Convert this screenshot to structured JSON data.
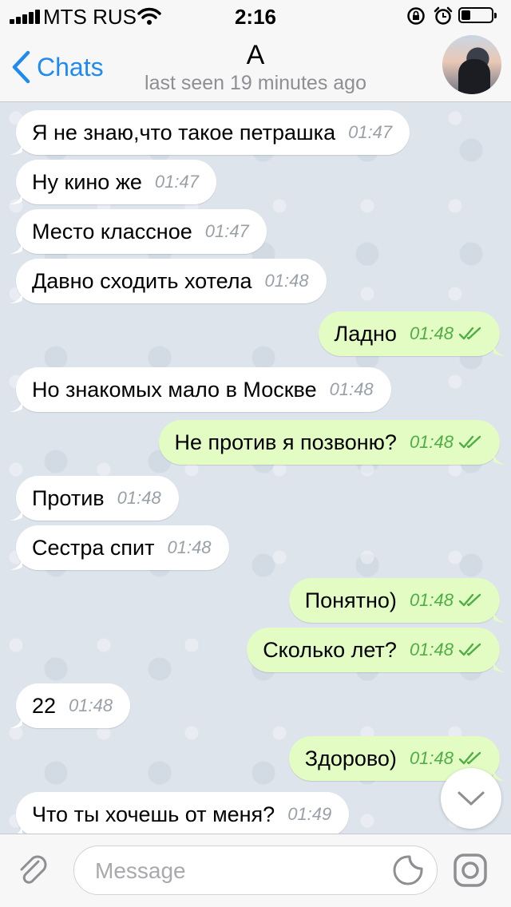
{
  "status_bar": {
    "carrier": "MTS RUS",
    "time": "2:16",
    "battery_level": 0.3
  },
  "header": {
    "back_label": "Chats",
    "title": "A",
    "subtitle": "last seen 19 minutes ago"
  },
  "messages": [
    {
      "dir": "in",
      "text": "Я не знаю,что такое петрашка",
      "time": "01:47"
    },
    {
      "dir": "in",
      "text": "Ну кино же",
      "time": "01:47"
    },
    {
      "dir": "in",
      "text": "Место классное",
      "time": "01:47"
    },
    {
      "dir": "in",
      "text": "Давно сходить хотела",
      "time": "01:48"
    },
    {
      "dir": "out",
      "text": "Ладно",
      "time": "01:48",
      "read": true
    },
    {
      "dir": "in",
      "text": "Но знакомых мало в Москве",
      "time": "01:48"
    },
    {
      "dir": "out",
      "text": "Не против я позвоню?",
      "time": "01:48",
      "read": true
    },
    {
      "dir": "in",
      "text": "Против",
      "time": "01:48"
    },
    {
      "dir": "in",
      "text": "Сестра спит",
      "time": "01:48"
    },
    {
      "dir": "out",
      "text": "Понятно)",
      "time": "01:48",
      "read": true
    },
    {
      "dir": "out",
      "text": "Сколько лет?",
      "time": "01:48",
      "read": true
    },
    {
      "dir": "in",
      "text": "22",
      "time": "01:48"
    },
    {
      "dir": "out",
      "text": "Здорово)",
      "time": "01:48",
      "read": true
    },
    {
      "dir": "in",
      "text": "Что ты хочешь от меня?",
      "time": "01:49"
    }
  ],
  "input": {
    "placeholder": "Message",
    "value": ""
  },
  "colors": {
    "accent": "#1f8bf0",
    "outgoing_bubble": "#e2fcc4",
    "incoming_bubble": "#ffffff",
    "read_check": "#4fae44"
  },
  "icons": {
    "back": "chevron-left-icon",
    "attach": "paperclip-icon",
    "sticker": "sticker-icon",
    "camera": "camera-icon",
    "scroll": "chevron-down-icon",
    "checks": "double-check-icon"
  }
}
